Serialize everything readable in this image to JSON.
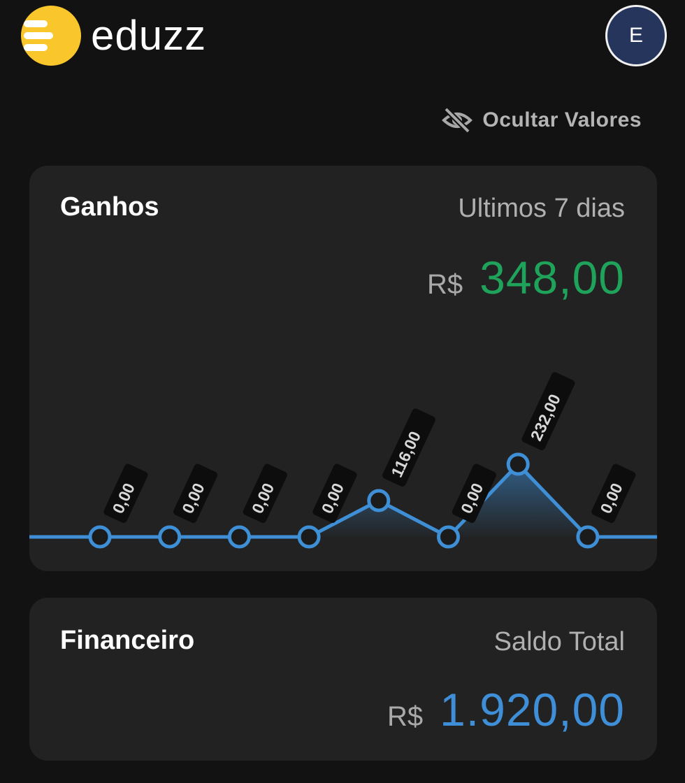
{
  "brand": {
    "name": "eduzz",
    "logo_color": "#F9C72C"
  },
  "user": {
    "avatar_initial": "E"
  },
  "toolbar": {
    "hide_values_label": "Ocultar Valores",
    "hide_values_icon": "eye-off-icon"
  },
  "earnings": {
    "title": "Ganhos",
    "period": "Ultimos 7 dias",
    "currency": "R$",
    "total": "348,00",
    "total_color": "#1FA35A"
  },
  "finance": {
    "title": "Financeiro",
    "subtitle": "Saldo Total",
    "currency": "R$",
    "total": "1.920,00",
    "total_color": "#3F8FD8"
  },
  "chart_data": {
    "type": "area",
    "x": [
      1,
      2,
      3,
      4,
      5,
      6,
      7,
      8
    ],
    "values": [
      0,
      0,
      0,
      0,
      116,
      0,
      232,
      0
    ],
    "labels": [
      "0,00",
      "0,00",
      "0,00",
      "0,00",
      "116,00",
      "0,00",
      "232,00",
      "0,00"
    ],
    "ylim": [
      0,
      232
    ],
    "grid": false,
    "legend": "none",
    "line_color": "#3E8FD6"
  }
}
